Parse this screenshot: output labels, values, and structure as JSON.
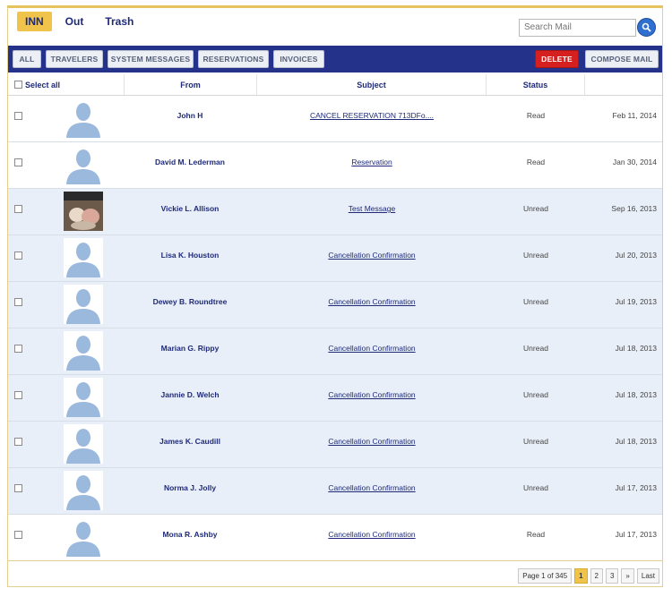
{
  "tabs": [
    {
      "label": "INN",
      "active": true
    },
    {
      "label": "Out",
      "active": false
    },
    {
      "label": "Trash",
      "active": false
    }
  ],
  "search": {
    "placeholder": "Search Mail"
  },
  "toolbar": {
    "filters": [
      "ALL",
      "TRAVELERS",
      "SYSTEM MESSAGES",
      "RESERVATIONS",
      "INVOICES"
    ],
    "delete_label": "DELETE",
    "compose_label": "COMPOSE MAIL"
  },
  "table": {
    "select_all": "Select all",
    "headers": {
      "from": "From",
      "subject": "Subject",
      "status": "Status"
    },
    "rows": [
      {
        "from": "John H",
        "subject": "CANCEL RESERVATION 713DFo....",
        "status": "Read",
        "date": "Feb 11, 2014",
        "avatar": "default"
      },
      {
        "from": "David M. Lederman",
        "subject": "Reservation",
        "status": "Read",
        "date": "Jan 30, 2014",
        "avatar": "default"
      },
      {
        "from": "Vickie L. Allison",
        "subject": "Test Message",
        "status": "Unread",
        "date": "Sep 16, 2013",
        "avatar": "photo"
      },
      {
        "from": "Lisa K. Houston",
        "subject": "Cancellation Confirmation",
        "status": "Unread",
        "date": "Jul 20, 2013",
        "avatar": "default"
      },
      {
        "from": "Dewey B. Roundtree",
        "subject": "Cancellation Confirmation",
        "status": "Unread",
        "date": "Jul 19, 2013",
        "avatar": "default"
      },
      {
        "from": "Marian G. Rippy",
        "subject": "Cancellation Confirmation",
        "status": "Unread",
        "date": "Jul 18, 2013",
        "avatar": "default"
      },
      {
        "from": "Jannie D. Welch",
        "subject": "Cancellation Confirmation",
        "status": "Unread",
        "date": "Jul 18, 2013",
        "avatar": "default"
      },
      {
        "from": "James K. Caudill",
        "subject": "Cancellation Confirmation",
        "status": "Unread",
        "date": "Jul 18, 2013",
        "avatar": "default"
      },
      {
        "from": "Norma J. Jolly",
        "subject": "Cancellation Confirmation",
        "status": "Unread",
        "date": "Jul 17, 2013",
        "avatar": "default"
      },
      {
        "from": "Mona R. Ashby",
        "subject": "Cancellation Confirmation",
        "status": "Read",
        "date": "Jul 17, 2013",
        "avatar": "default"
      }
    ]
  },
  "pagination": {
    "summary": "Page 1 of 345",
    "pages": [
      "1",
      "2",
      "3"
    ],
    "next": "»",
    "last": "Last"
  },
  "colors": {
    "nav": "#24328a",
    "accent": "#f0c44a",
    "delete": "#d62020",
    "unread_row": "#e9eff8"
  }
}
